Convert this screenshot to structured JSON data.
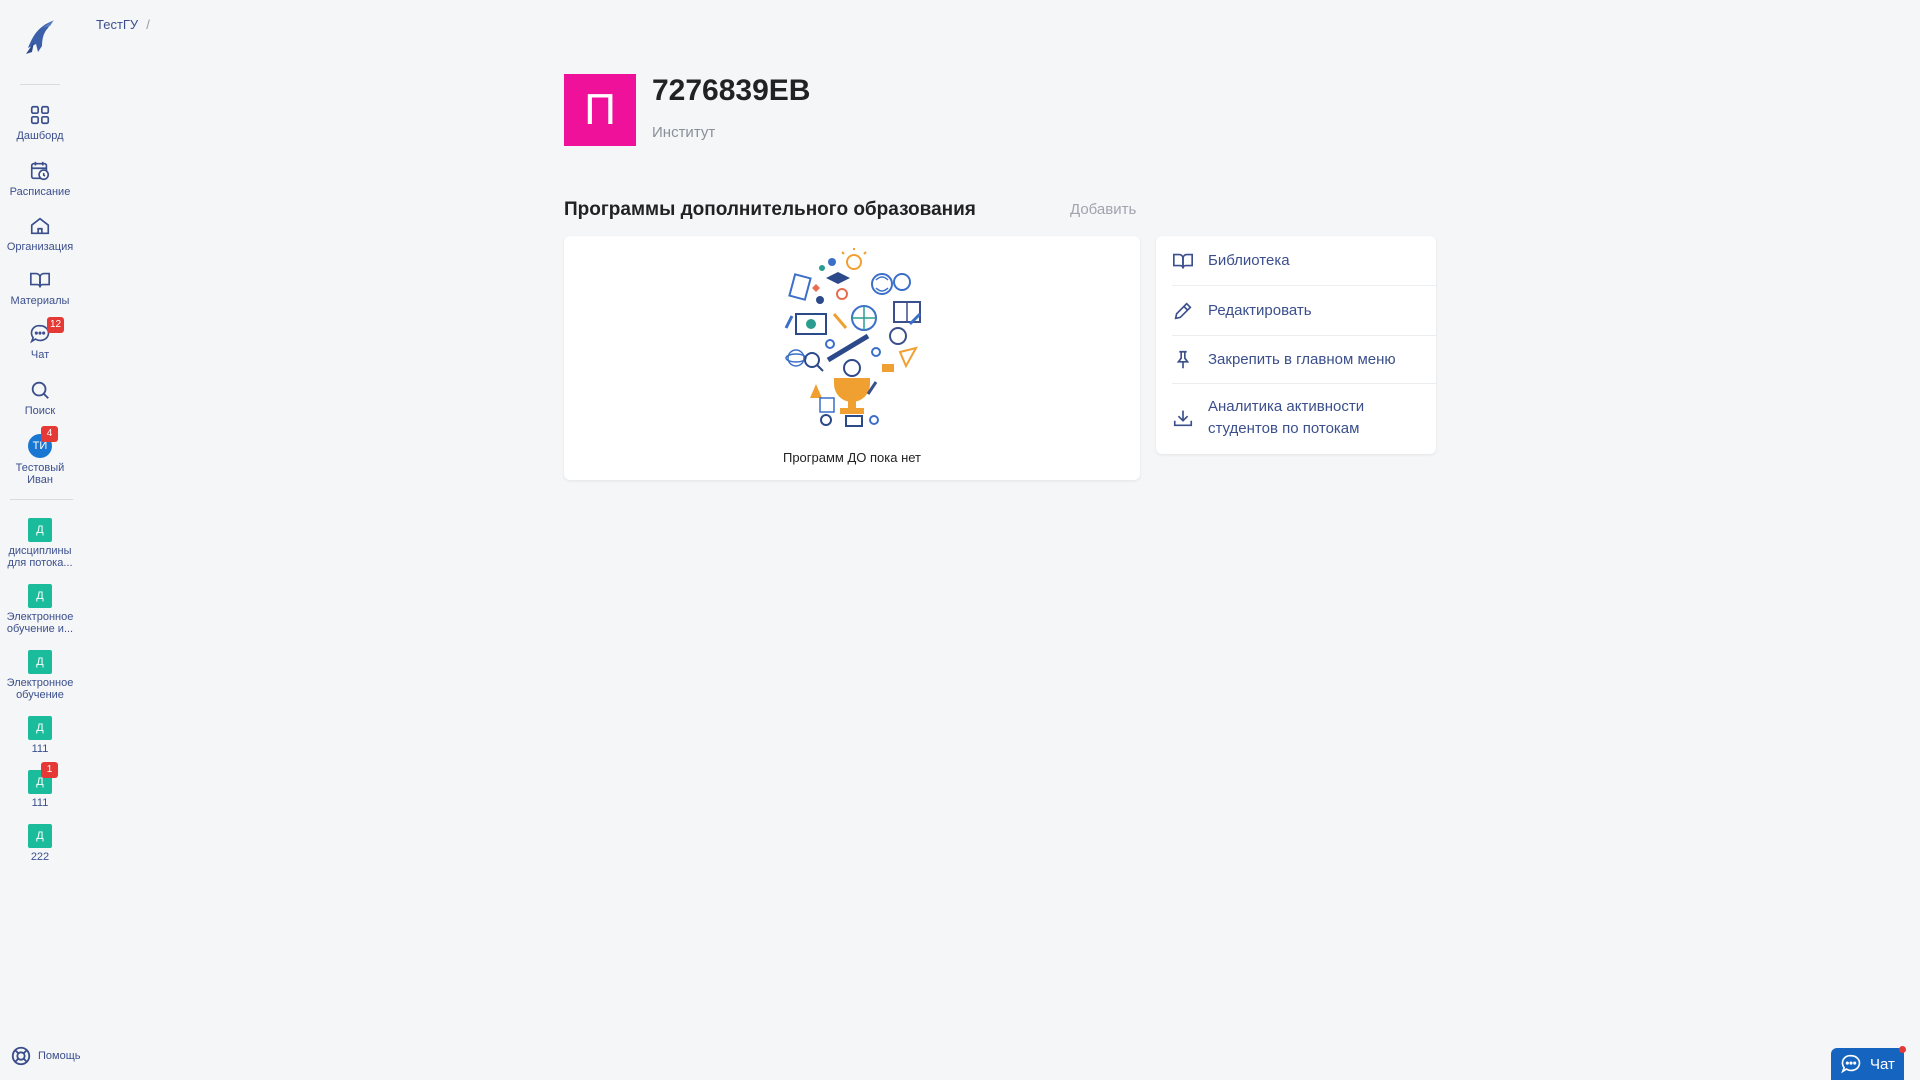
{
  "breadcrumb": {
    "root": "ТестГУ",
    "separator": "/"
  },
  "sidebar": {
    "nav": [
      {
        "label": "Дашборд",
        "icon": "dashboard-icon"
      },
      {
        "label": "Расписание",
        "icon": "schedule-icon"
      },
      {
        "label": "Организация",
        "icon": "organization-icon"
      },
      {
        "label": "Материалы",
        "icon": "book-icon"
      },
      {
        "label": "Чат",
        "icon": "chat-icon",
        "badge": "12"
      },
      {
        "label": "Поиск",
        "icon": "search-icon"
      }
    ],
    "user": {
      "initials": "ТИ",
      "name": "Тестовый Иван",
      "badge": "4"
    },
    "disciplines": [
      {
        "letter": "Д",
        "label": "дисциплины для потока..."
      },
      {
        "letter": "Д",
        "label": "Электронное обучение и..."
      },
      {
        "letter": "Д",
        "label": "Электронное обучение"
      },
      {
        "letter": "Д",
        "label": "111"
      },
      {
        "letter": "Д",
        "label": "111",
        "badge": "1"
      },
      {
        "letter": "Д",
        "label": "222"
      }
    ],
    "help": "Помощь"
  },
  "org": {
    "initial": "П",
    "title": "7276839ЕВ",
    "subtitle": "Институт"
  },
  "programs": {
    "title": "Программы дополнительного образования",
    "add": "Добавить",
    "empty": "Программ ДО пока нет"
  },
  "menu": [
    {
      "label": "Библиотека",
      "icon": "book-icon"
    },
    {
      "label": "Редактировать",
      "icon": "pencil-icon"
    },
    {
      "label": "Закрепить в главном меню",
      "icon": "pin-icon"
    },
    {
      "label": "Аналитика активности студентов по потокам",
      "icon": "download-icon"
    }
  ],
  "chat_widget": {
    "label": "Чат"
  },
  "colors": {
    "accent": "#3b4f8c",
    "org_avatar": "#f0119b",
    "discipline": "#1abc9c",
    "badge": "#e53935",
    "chat": "#1565c0"
  }
}
